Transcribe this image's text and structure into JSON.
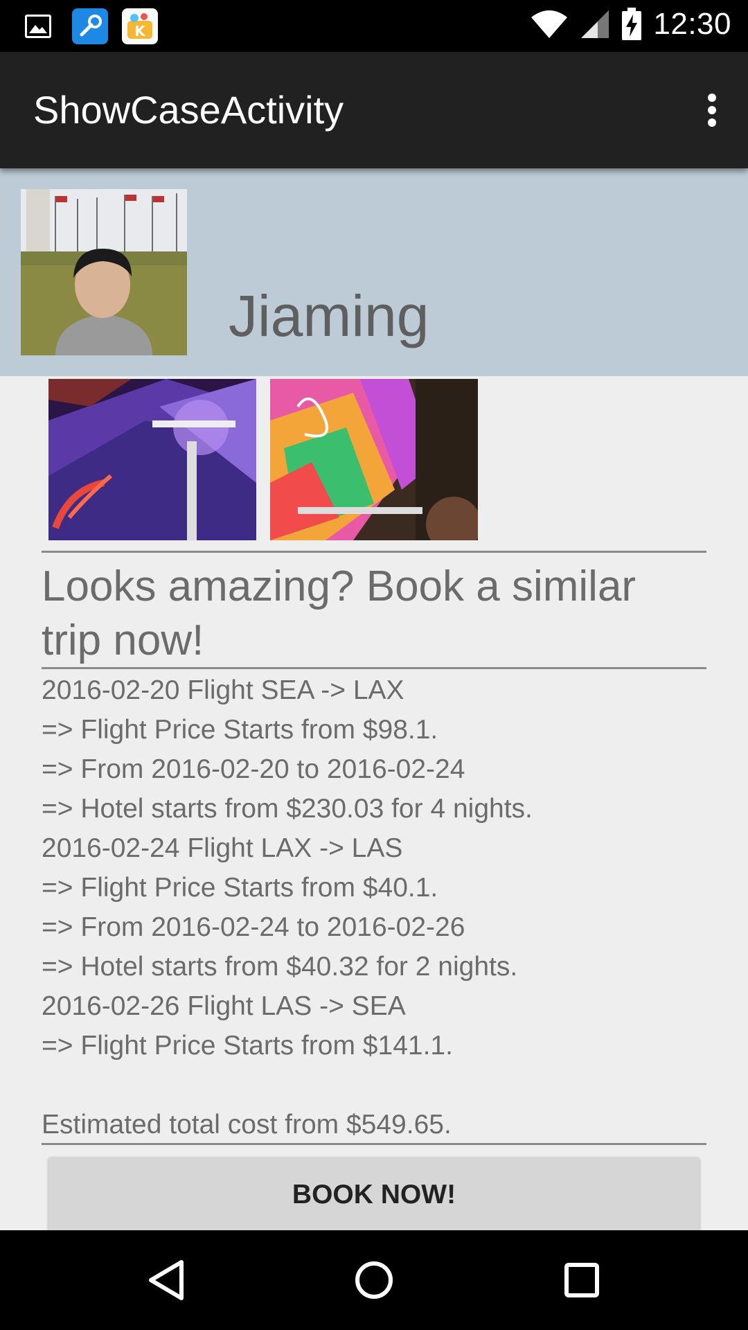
{
  "status_bar": {
    "time": "12:30",
    "notification_icons": [
      "image-icon",
      "tools-icon",
      "kiwi-app-icon"
    ],
    "system_icons": [
      "wifi-icon",
      "cell-signal-icon",
      "battery-charging-icon"
    ]
  },
  "action_bar": {
    "title": "ShowCaseActivity",
    "overflow_icon": "overflow-menu-icon"
  },
  "profile": {
    "name": "Jiaming"
  },
  "photos": [
    "photo-1",
    "photo-2"
  ],
  "promo": {
    "title": "Looks amazing? Book a similar trip now!"
  },
  "itinerary": [
    "2016-02-20 Flight SEA -> LAX",
    "=> Flight Price Starts from $98.1.",
    "=> From 2016-02-20 to 2016-02-24",
    "=> Hotel starts from $230.03 for 4 nights.",
    "2016-02-24 Flight LAX -> LAS",
    "=> Flight Price Starts from $40.1.",
    "=> From 2016-02-24 to 2016-02-26",
    "=> Hotel starts from $40.32 for 2 nights.",
    "2016-02-26 Flight LAS -> SEA",
    "=> Flight Price Starts from $141.1."
  ],
  "total": "Estimated total cost from $549.65.",
  "book_button": "BOOK NOW!",
  "nav_bar": {
    "icons": [
      "back-icon",
      "home-icon",
      "recents-icon"
    ]
  },
  "colors": {
    "status_bar": "#000000",
    "action_bar": "#212121",
    "profile_header": "#bccbd6",
    "page_background": "#eeeeee",
    "text": "#6b6b6b",
    "button": "#d6d6d6"
  }
}
